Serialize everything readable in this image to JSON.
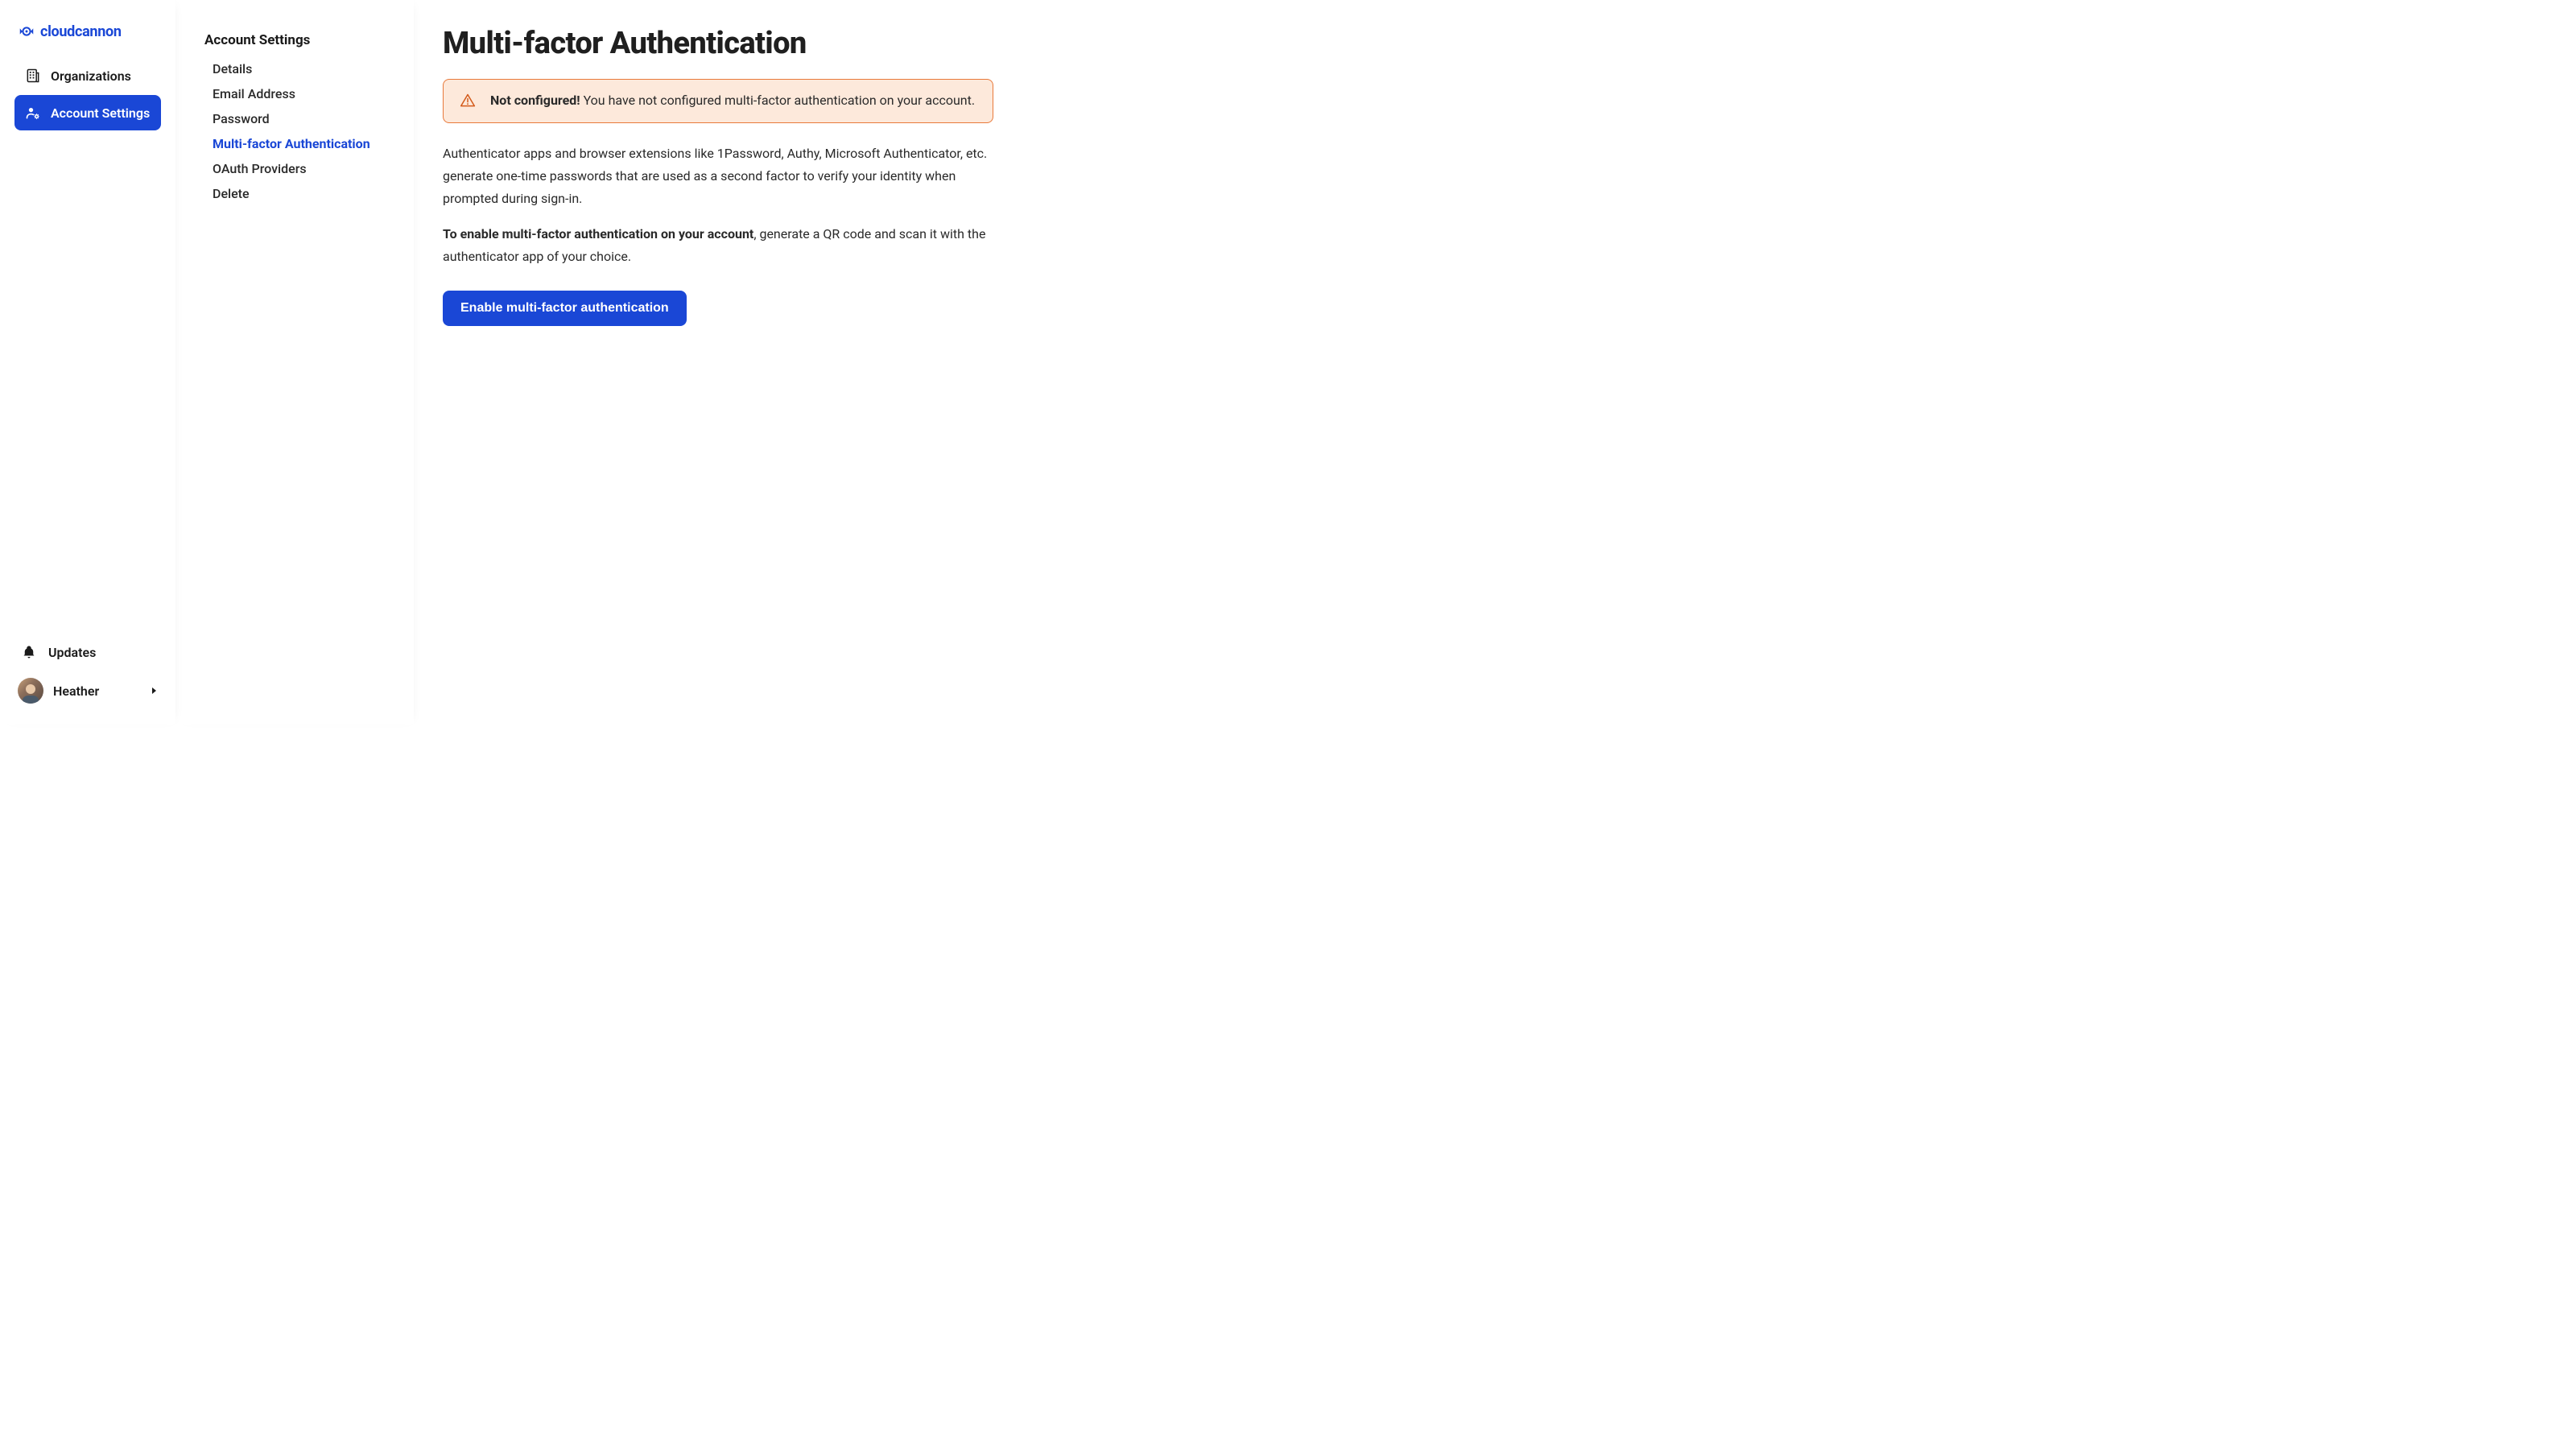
{
  "brand": {
    "name": "cloudcannon"
  },
  "primary_nav": {
    "items": [
      {
        "label": "Organizations",
        "icon": "building",
        "active": false
      },
      {
        "label": "Account Settings",
        "icon": "user-cog",
        "active": true
      }
    ],
    "bottom": {
      "updates_label": "Updates",
      "user_name": "Heather"
    }
  },
  "secondary_nav": {
    "heading": "Account Settings",
    "items": [
      {
        "label": "Details",
        "active": false
      },
      {
        "label": "Email Address",
        "active": false
      },
      {
        "label": "Password",
        "active": false
      },
      {
        "label": "Multi-factor Authentication",
        "active": true
      },
      {
        "label": "OAuth Providers",
        "active": false
      },
      {
        "label": "Delete",
        "active": false
      }
    ]
  },
  "main": {
    "title": "Multi-factor Authentication",
    "alert": {
      "strong": "Not configured!",
      "text": " You have not configured multi-factor authentication on your account."
    },
    "para1": "Authenticator apps and browser extensions like 1Password, Authy, Microsoft Authenticator, etc. generate one-time passwords that are used as a second factor to verify your identity when prompted during sign-in.",
    "para2_strong": "To enable multi-factor authentication on your account",
    "para2_rest": ", generate a QR code and scan it with the authenticator app of your choice.",
    "button_label": "Enable multi-factor authentication"
  },
  "colors": {
    "primary": "#1a47d6",
    "alert_border": "#e8793a",
    "alert_bg": "#fde9db"
  }
}
